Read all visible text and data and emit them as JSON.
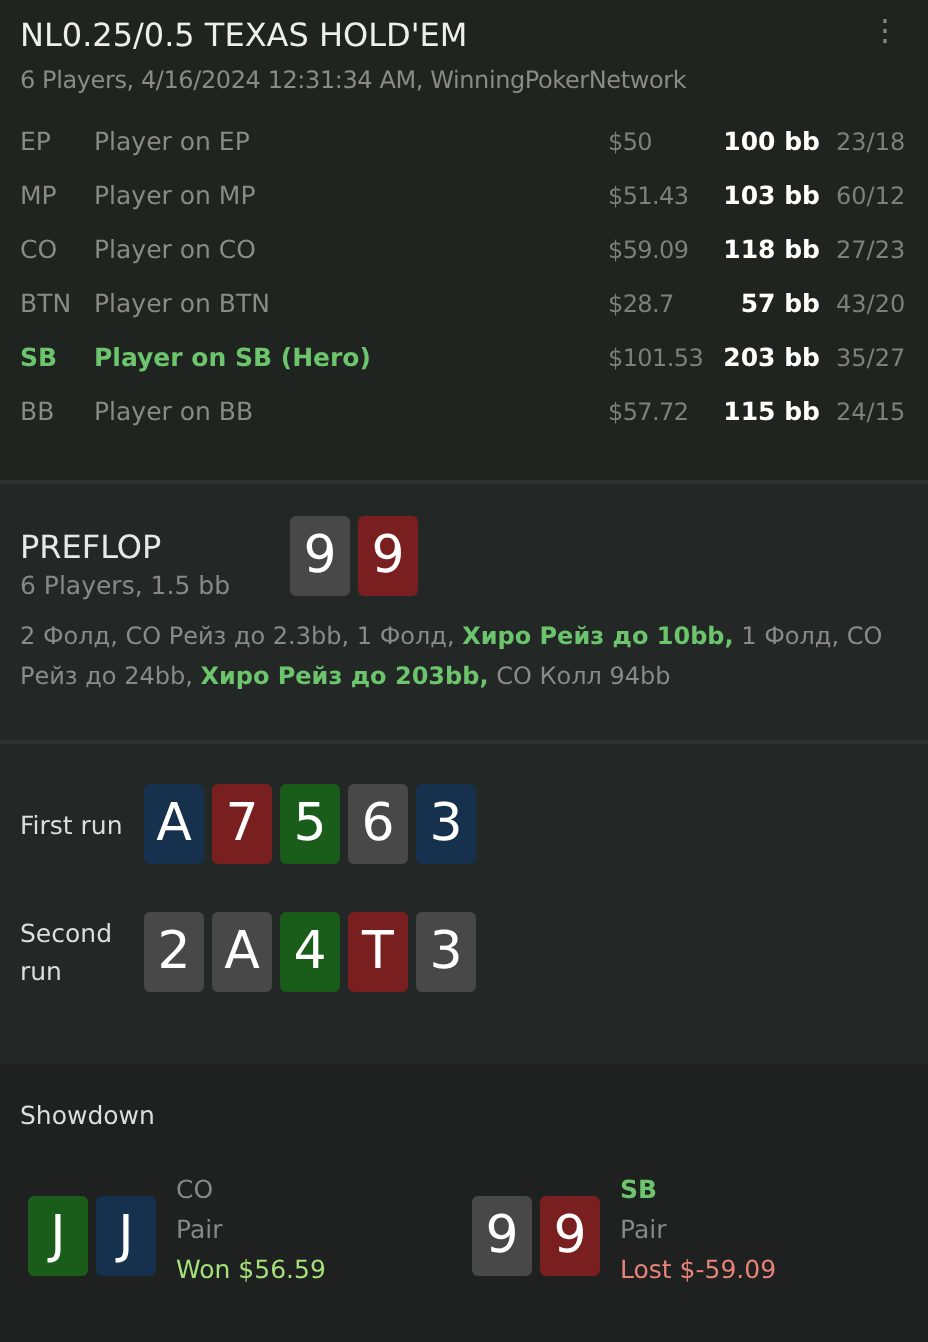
{
  "header": {
    "title": "NL0.25/0.5 TEXAS HOLD'EM",
    "menu_icon": "⋮",
    "subtitle": "6 Players, 4/16/2024 12:31:34 AM, WinningPokerNetwork"
  },
  "players": [
    {
      "position": "EP",
      "name": "Player on EP",
      "stack": "$50",
      "bb": "100 bb",
      "stats": "23/18",
      "hero": false
    },
    {
      "position": "MP",
      "name": "Player on MP",
      "stack": "$51.43",
      "bb": "103 bb",
      "stats": "60/12",
      "hero": false
    },
    {
      "position": "CO",
      "name": "Player on CO",
      "stack": "$59.09",
      "bb": "118 bb",
      "stats": "27/23",
      "hero": false
    },
    {
      "position": "BTN",
      "name": "Player on BTN",
      "stack": "$28.7",
      "bb": "57 bb",
      "stats": "43/20",
      "hero": false
    },
    {
      "position": "SB",
      "name": "Player on SB (Hero)",
      "stack": "$101.53",
      "bb": "203 bb",
      "stats": "35/27",
      "hero": true
    },
    {
      "position": "BB",
      "name": "Player on BB",
      "stack": "$57.72",
      "bb": "115 bb",
      "stats": "24/15",
      "hero": false
    }
  ],
  "preflop": {
    "title": "PREFLOP",
    "info": "6 Players, 1.5 bb",
    "cards": [
      {
        "rank": "9",
        "color": "#484848"
      },
      {
        "rank": "9",
        "color": "#7a1f1f"
      }
    ],
    "actions": "2 Фолд, CO Рейз до 2.3bb, 1 Фолд, **Хиро Рейз до 10bb,** 1 Фолд, CO Рейз до 24bb, **Хиро Рейз до 203bb,** CO Колл 94bb"
  },
  "runs": [
    {
      "label": "First run",
      "cards": [
        {
          "rank": "A",
          "color": "#15314d"
        },
        {
          "rank": "7",
          "color": "#7a1f1f"
        },
        {
          "rank": "5",
          "color": "#1a5c1a"
        },
        {
          "rank": "6",
          "color": "#484848"
        },
        {
          "rank": "3",
          "color": "#15314d"
        }
      ]
    },
    {
      "label": "Second run",
      "cards": [
        {
          "rank": "2",
          "color": "#484848"
        },
        {
          "rank": "A",
          "color": "#484848"
        },
        {
          "rank": "4",
          "color": "#1a5c1a"
        },
        {
          "rank": "T",
          "color": "#7a1f1f"
        },
        {
          "rank": "3",
          "color": "#484848"
        }
      ]
    }
  ],
  "showdown": {
    "title": "Showdown",
    "hands": [
      {
        "cards": [
          {
            "rank": "J",
            "color": "#1a5c1a"
          },
          {
            "rank": "J",
            "color": "#15314d"
          }
        ],
        "position": "CO",
        "hero": false,
        "hand": "Pair",
        "result": "Won $56.59",
        "kind": "won"
      },
      {
        "cards": [
          {
            "rank": "9",
            "color": "#484848"
          },
          {
            "rank": "9",
            "color": "#7a1f1f"
          }
        ],
        "position": "SB",
        "hero": true,
        "hand": "Pair",
        "result": "Lost $-59.09",
        "kind": "lost"
      }
    ]
  }
}
